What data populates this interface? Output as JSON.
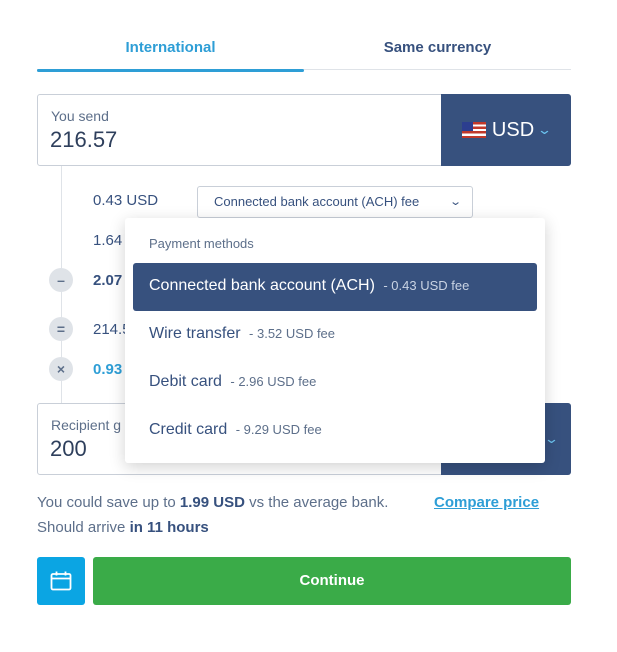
{
  "tabs": [
    {
      "label": "International",
      "active": true
    },
    {
      "label": "Same currency",
      "active": false
    }
  ],
  "send": {
    "label": "You send",
    "value": "216.57",
    "currency": "USD"
  },
  "breakdown": {
    "fee_amount": "0.43 USD",
    "fee_selector_label": "Connected bank account (ACH) fee",
    "row2_partial": "1.64",
    "row3_partial": "2.07",
    "row4_partial": "214.5",
    "row5_partial": "0.93",
    "ops": {
      "minus": "–",
      "equals": "=",
      "times": "×"
    }
  },
  "dropdown": {
    "header": "Payment methods",
    "items": [
      {
        "label": "Connected bank account (ACH)",
        "fee": "- 0.43 USD fee",
        "selected": true
      },
      {
        "label": "Wire transfer",
        "fee": "- 3.52 USD fee",
        "selected": false
      },
      {
        "label": "Debit card",
        "fee": "- 2.96 USD fee",
        "selected": false
      },
      {
        "label": "Credit card",
        "fee": "- 9.29 USD fee",
        "selected": false
      }
    ]
  },
  "recipient": {
    "label_partial": "Recipient g",
    "value": "200"
  },
  "info": {
    "save_prefix": "You could save up to ",
    "save_amount": "1.99 USD",
    "save_suffix": " vs the average bank.",
    "compare_link": "Compare price",
    "arrive_prefix": "Should arrive ",
    "arrive_time": "in 11 hours"
  },
  "actions": {
    "calendar_icon": "calendar-icon",
    "continue_label": "Continue"
  },
  "colors": {
    "accent": "#2e9ed6",
    "navy": "#37517e",
    "primary_button": "#3aab48",
    "calendar_button": "#0ba5e3"
  }
}
